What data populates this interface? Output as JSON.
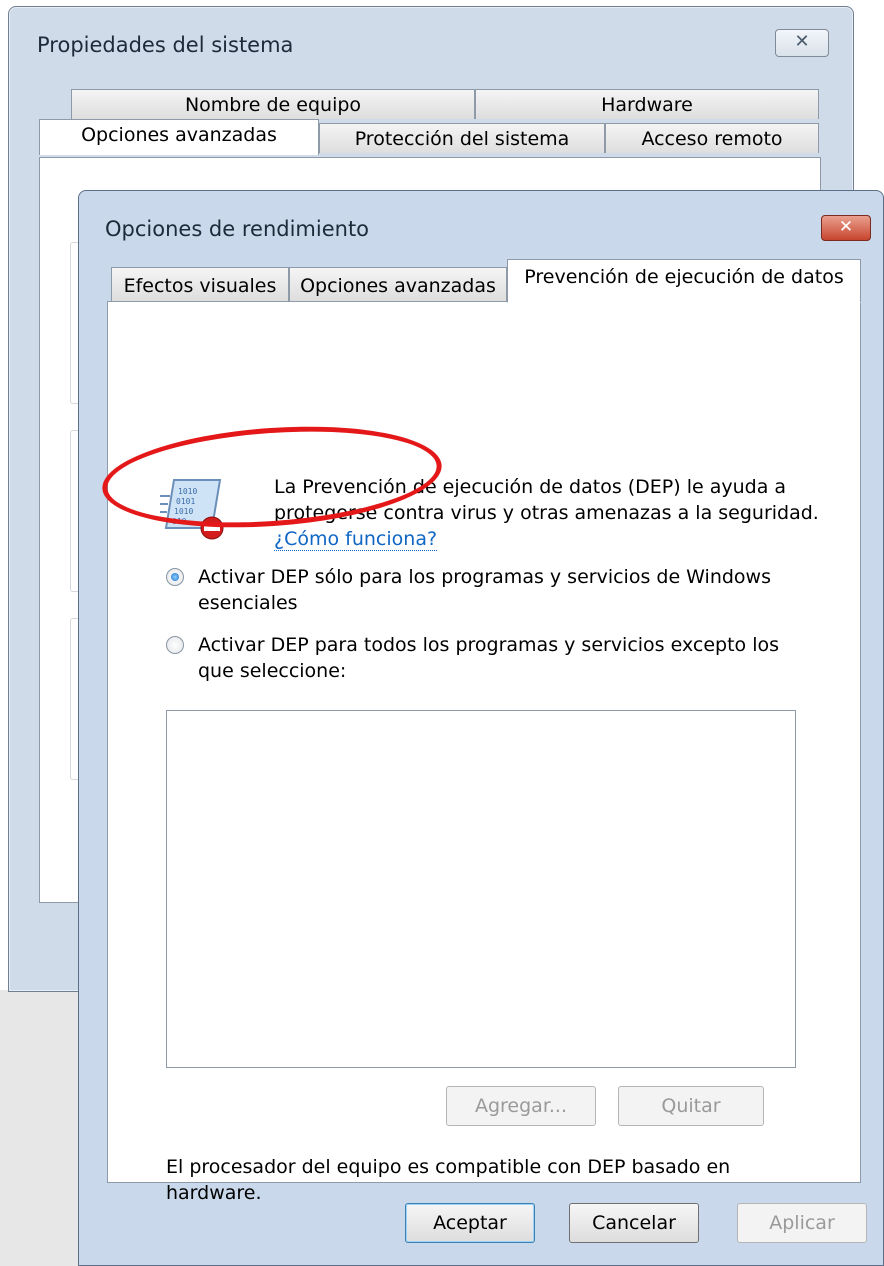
{
  "back_window": {
    "title": "Propiedades del sistema",
    "tabs_top": [
      "Nombre de equipo",
      "Hardware"
    ],
    "tabs_bottom": [
      "Opciones avanzadas",
      "Protección del sistema",
      "Acceso remoto"
    ]
  },
  "front_window": {
    "title": "Opciones de rendimiento",
    "tabs": [
      "Efectos visuales",
      "Opciones avanzadas",
      "Prevención de ejecución de datos"
    ],
    "active_tab": "Prevención de ejecución de datos",
    "intro_text": "La Prevención de ejecución de datos (DEP) le ayuda a protegerse contra virus y otras amenazas a la seguridad.",
    "intro_link": "¿Cómo funciona?",
    "radio_essential": "Activar DEP sólo para los programas y servicios de Windows esenciales",
    "radio_all": "Activar DEP para todos los programas y servicios excepto los que seleccione:",
    "selected_option": "essential",
    "add_button": "Agregar...",
    "remove_button": "Quitar",
    "footer_text": "El procesador del equipo es compatible con DEP basado en hardware.",
    "ok_button": "Aceptar",
    "cancel_button": "Cancelar",
    "apply_button": "Aplicar"
  },
  "icons": {
    "close": "close-icon",
    "dep": "dep-shield-icon",
    "annotation": "red-circle-annotation"
  },
  "colors": {
    "link": "#0f66c4",
    "annotation": "#e41818",
    "close_button": "#c8452e"
  }
}
